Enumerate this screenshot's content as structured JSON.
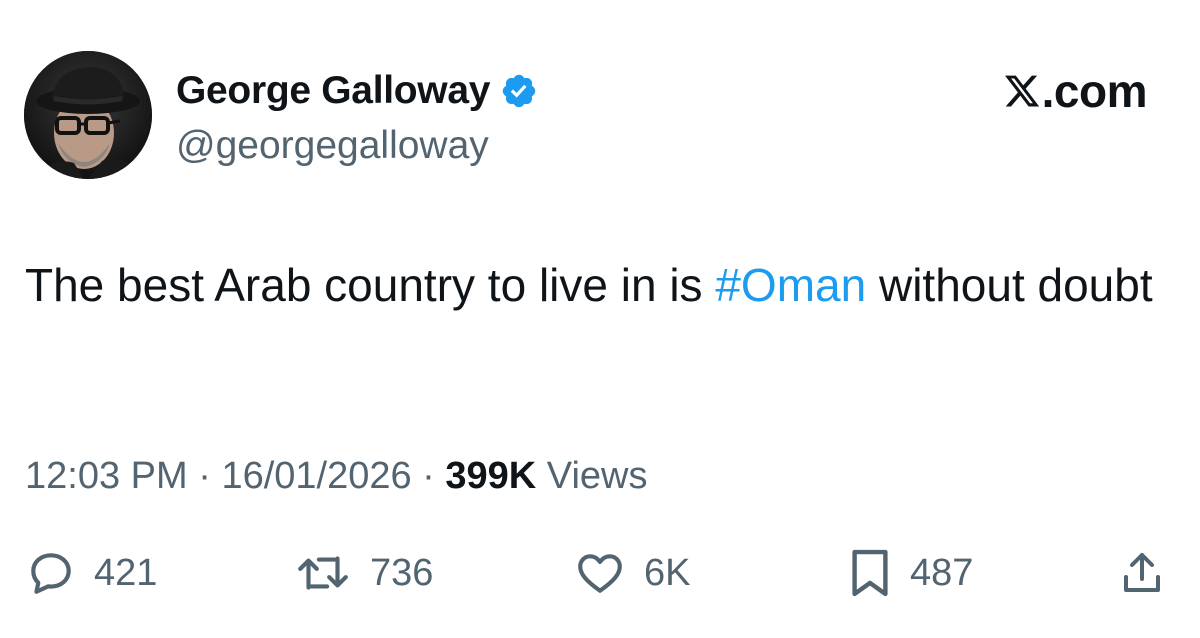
{
  "author": {
    "display_name": "George Galloway",
    "handle": "@georgegalloway",
    "verified": true,
    "verified_color": "#1d9bf0",
    "avatar": "avatar-photo"
  },
  "brand": {
    "glyph": "𝕏",
    "suffix": ".com"
  },
  "tweet": {
    "text_before": "The best Arab country to live in is ",
    "hashtag": "#Oman",
    "text_after": " without doubt",
    "hashtag_color": "#1d9bf0"
  },
  "meta": {
    "time": "12:03 PM",
    "separator": " · ",
    "date": "16/01/2026",
    "views_count": "399K",
    "views_label": " Views"
  },
  "actions": {
    "replies": "421",
    "reposts": "736",
    "likes": "6K",
    "bookmarks": "487"
  },
  "icons": {
    "reply": "reply-icon",
    "repost": "repost-icon",
    "like": "heart-icon",
    "bookmark": "bookmark-icon",
    "share": "share-icon",
    "verified": "verified-badge-icon"
  }
}
